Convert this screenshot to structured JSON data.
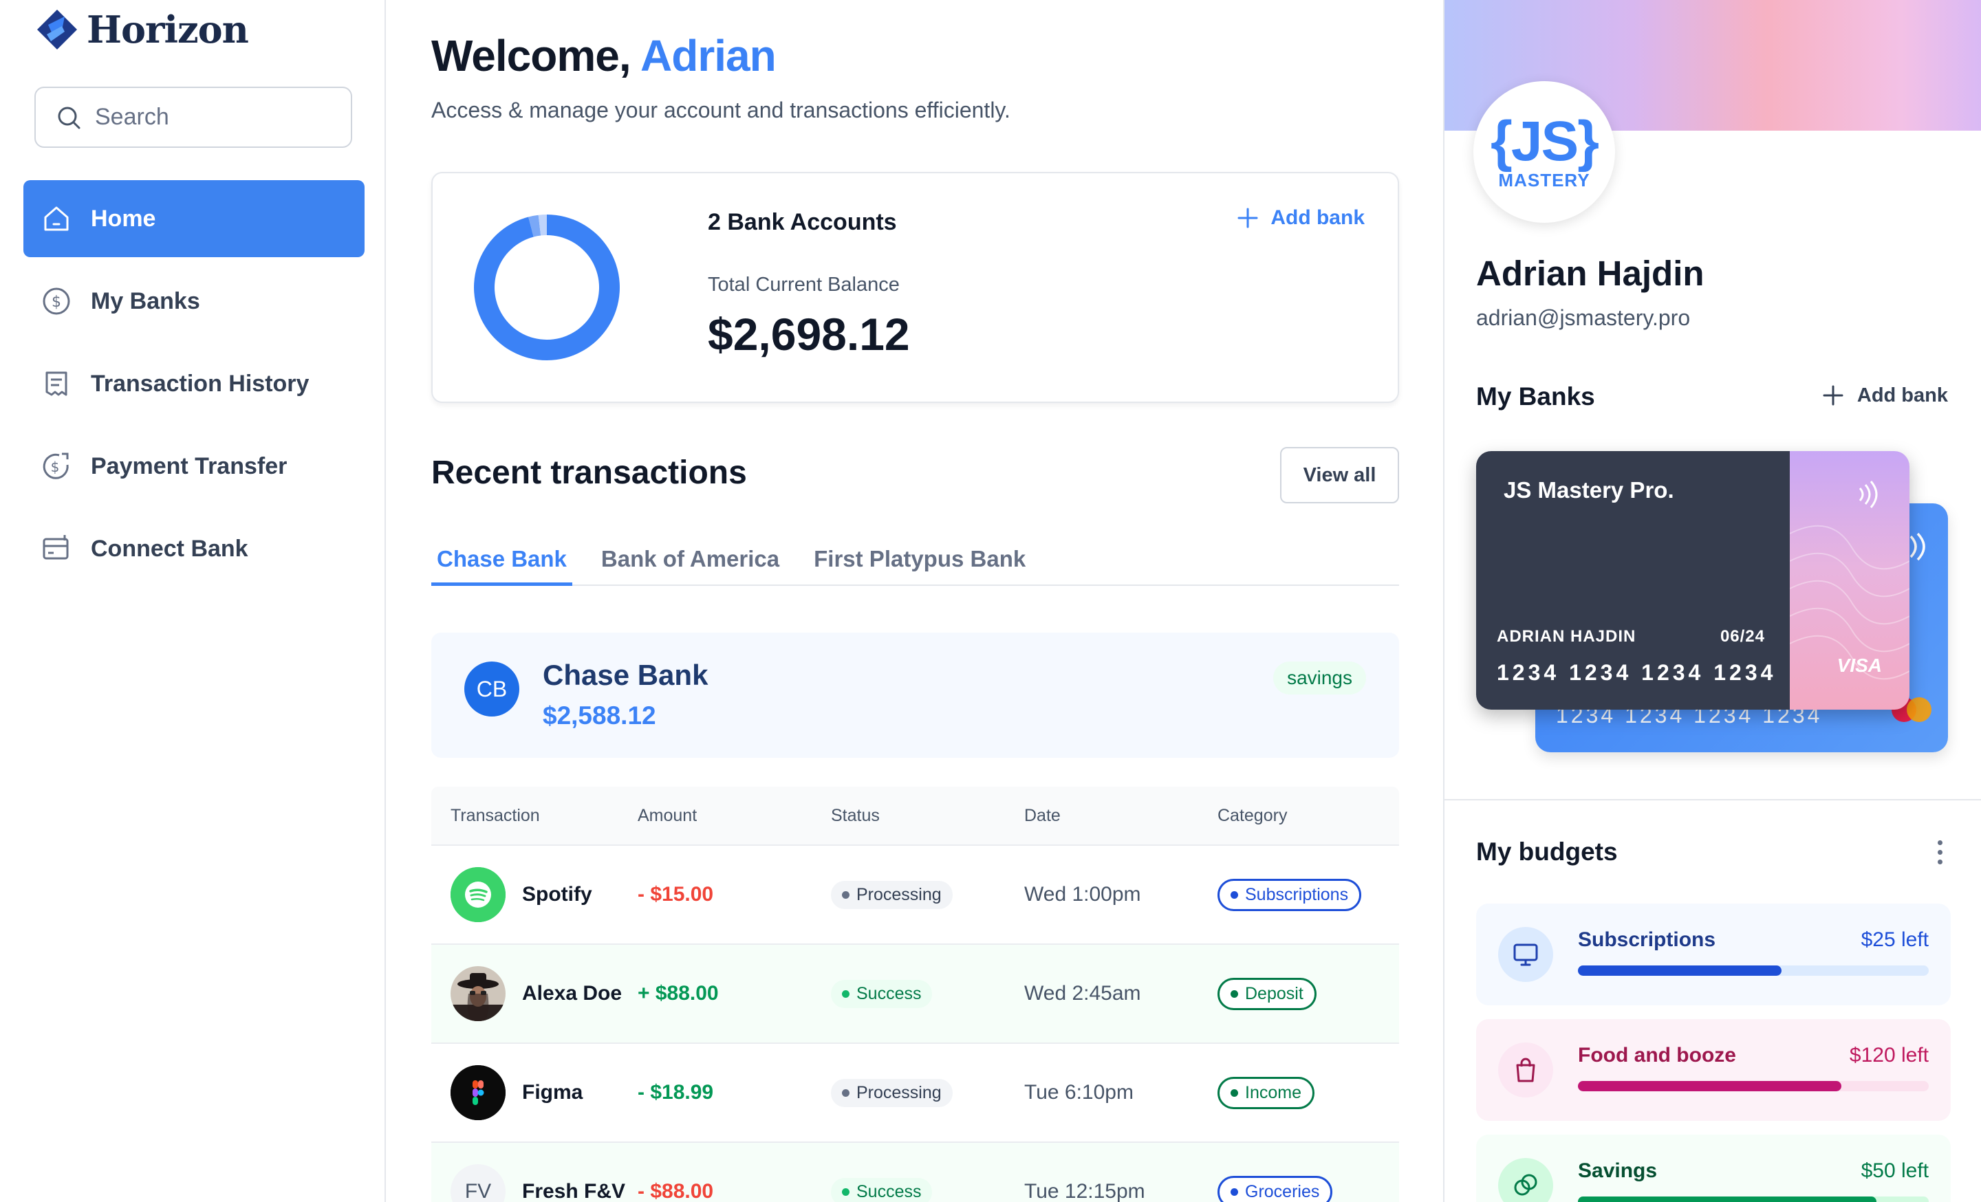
{
  "sidebar": {
    "logo_text": "Horizon",
    "search_placeholder": "Search",
    "items": [
      {
        "label": "Home",
        "icon": "home-icon",
        "active": true
      },
      {
        "label": "My Banks",
        "icon": "dollar-circle-icon"
      },
      {
        "label": "Transaction History",
        "icon": "receipt-icon"
      },
      {
        "label": "Payment Transfer",
        "icon": "money-send-icon"
      },
      {
        "label": "Connect Bank",
        "icon": "credit-card-add-icon"
      }
    ]
  },
  "header": {
    "welcome": "Welcome,",
    "user_first_name": "Adrian",
    "subtitle": "Access & manage your account and transactions efficiently."
  },
  "balance_card": {
    "accounts_label": "2 Bank Accounts",
    "total_label": "Total Current Balance",
    "total_value": "$2,698.12",
    "add_bank_label": "Add bank",
    "donut_segments": [
      {
        "value": 2588.12,
        "color": "#3b82f6"
      },
      {
        "value": 60,
        "color": "#7aa8f7"
      },
      {
        "value": 50,
        "color": "#bfd4fb"
      }
    ]
  },
  "recent": {
    "title": "Recent transactions",
    "view_all_label": "View all",
    "tabs": [
      "Chase Bank",
      "Bank of America",
      "First Platypus Bank"
    ],
    "active_tab": 0,
    "bank": {
      "initials": "CB",
      "name": "Chase Bank",
      "balance": "$2,588.12",
      "type": "savings"
    },
    "columns": [
      "Transaction",
      "Amount",
      "Status",
      "Date",
      "Category"
    ],
    "rows": [
      {
        "name": "Spotify",
        "avatar": "spotify-logo-icon",
        "amount": "- $15.00",
        "amount_color": "#f04438",
        "status": "Processing",
        "date": "Wed 1:00pm",
        "category": "Subscriptions",
        "category_color": "#1d4ed8"
      },
      {
        "name": "Alexa Doe",
        "avatar": "user-photo-avatar",
        "amount": "+ $88.00",
        "amount_color": "#039855",
        "status": "Success",
        "date": "Wed 2:45am",
        "category": "Deposit",
        "category_color": "#027a48"
      },
      {
        "name": "Figma",
        "avatar": "figma-logo-icon",
        "amount": "- $18.99",
        "amount_color": "#039855",
        "status": "Processing",
        "date": "Tue 6:10pm",
        "category": "Income",
        "category_color": "#027a48"
      },
      {
        "name": "Fresh F&V",
        "avatar_initials": "FV",
        "amount": "- $88.00",
        "amount_color": "#f04438",
        "status": "Success",
        "date": "Tue 12:15pm",
        "category": "Groceries",
        "category_color": "#1d4ed8"
      }
    ]
  },
  "profile": {
    "avatar_logo": "{JS}",
    "avatar_sub": "MASTERY",
    "name": "Adrian Hajdin",
    "email": "adrian@jsmastery.pro",
    "my_banks_title": "My Banks",
    "add_bank_label": "Add bank"
  },
  "cards": {
    "front": {
      "title": "JS Mastery Pro.",
      "holder": "ADRIAN HAJDIN",
      "expiry": "06/24",
      "number": "1234 1234 1234 1234",
      "brand": "VISA"
    },
    "back": {
      "number": "1234 1234 1234 1234"
    }
  },
  "budgets": {
    "title": "My budgets",
    "items": [
      {
        "name": "Subscriptions",
        "left": "$25 left",
        "progress": 0.58,
        "icon": "monitor-icon"
      },
      {
        "name": "Food and booze",
        "left": "$120 left",
        "progress": 0.75,
        "icon": "shopping-bag-icon"
      },
      {
        "name": "Savings",
        "left": "$50 left",
        "progress": 0.85,
        "icon": "coins-icon"
      }
    ]
  }
}
